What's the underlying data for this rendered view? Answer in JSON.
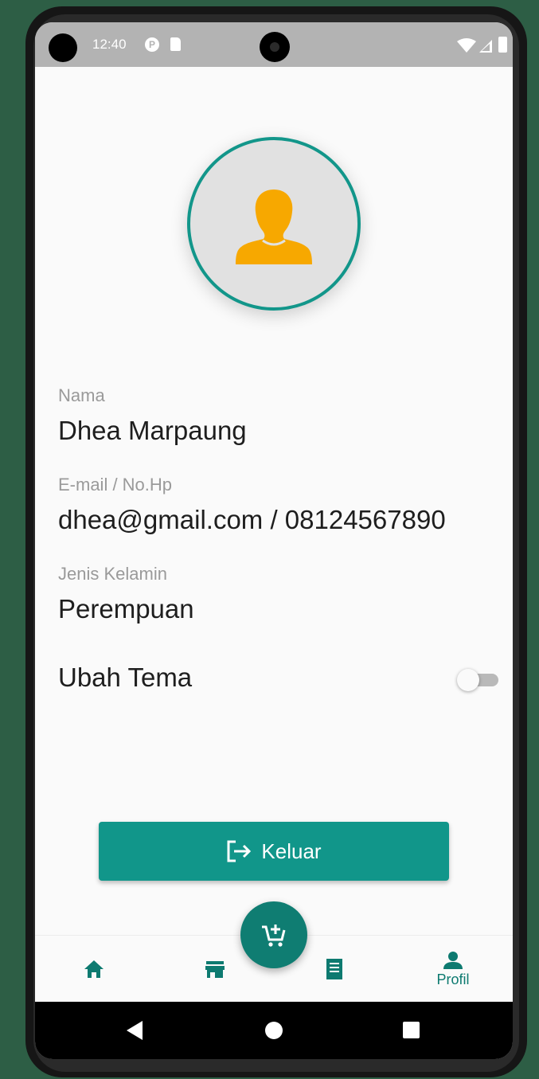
{
  "status_bar": {
    "time": "12:40",
    "notification_icons": [
      "p-icon",
      "sd-card-icon"
    ],
    "right_icons": [
      "wifi-icon",
      "signal-icon",
      "battery-icon"
    ]
  },
  "profile": {
    "avatar_icon": "person-icon",
    "accent_color": "#12968a",
    "avatar_color": "#f7a800",
    "fields": [
      {
        "label": "Nama",
        "value": "Dhea Marpaung"
      },
      {
        "label": "E-mail / No.Hp",
        "value": "dhea@gmail.com / 08124567890"
      },
      {
        "label": "Jenis Kelamin",
        "value": "Perempuan"
      }
    ],
    "theme_toggle": {
      "label": "Ubah Tema",
      "on": false
    }
  },
  "logout_button": {
    "label": "Keluar",
    "icon": "logout-icon"
  },
  "fab": {
    "icon": "add-to-cart-icon"
  },
  "bottom_nav": {
    "items": [
      {
        "icon": "home-icon",
        "label": ""
      },
      {
        "icon": "store-icon",
        "label": ""
      },
      {
        "icon": "receipt-icon",
        "label": ""
      },
      {
        "icon": "person-icon",
        "label": "Profil"
      }
    ],
    "active_index": 3
  },
  "system_nav": {
    "icons": [
      "back-icon",
      "home-circle-icon",
      "recents-icon"
    ]
  }
}
